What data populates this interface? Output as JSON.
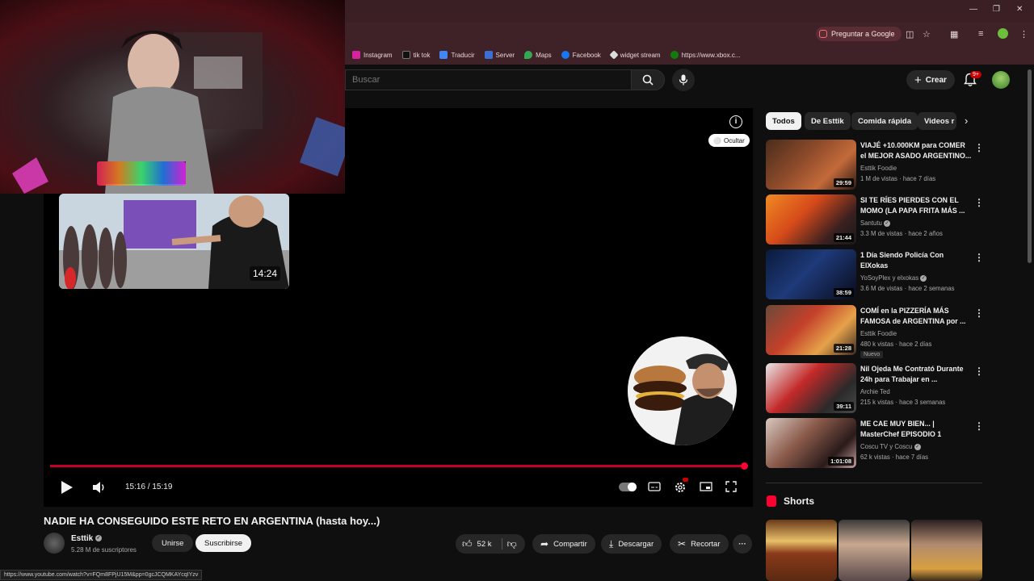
{
  "browser": {
    "ask_google": "Preguntar a Google",
    "bookmarks": [
      {
        "label": "Instagram",
        "color": "#d6249f"
      },
      {
        "label": "tik tok",
        "color": "#111111"
      },
      {
        "label": "Traducir",
        "color": "#4285f4"
      },
      {
        "label": "Server",
        "color": "#3b6fd6"
      },
      {
        "label": "Maps",
        "color": "#34a853"
      },
      {
        "label": "Facebook",
        "color": "#1877f2"
      },
      {
        "label": "widget stream",
        "color": "#dddddd"
      },
      {
        "label": "https://www.xbox.c...",
        "color": "#107c10"
      }
    ],
    "status_url": "https://www.youtube.com/watch?v=FQm8FPjU15M&pp=0gcJCQMKAYcqIYzv"
  },
  "header": {
    "search_placeholder": "Buscar",
    "create_label": "Crear",
    "notification_count": "9+"
  },
  "player": {
    "end_thumb_duration": "14:24",
    "hide_label": "Ocultar",
    "time": "15:16 / 15:19",
    "progress": 0.997
  },
  "video": {
    "title": "NADIE HA CONSEGUIDO ESTE RETO EN ARGENTINA (hasta hoy...)",
    "channel": "Esttik",
    "subscribers": "5.28 M de suscriptores",
    "join_label": "Unirse",
    "subscribe_label": "Suscribirse",
    "likes": "52 k",
    "share_label": "Compartir",
    "download_label": "Descargar",
    "clip_label": "Recortar"
  },
  "sidebar": {
    "chips": [
      "Todos",
      "De Esttik",
      "Comida rápida",
      "Videos r"
    ],
    "recommendations": [
      {
        "title": "VIAJÉ +10.000KM para COMER el MEJOR ASADO ARGENTINO...",
        "channel": "Esttik Foodie",
        "meta": "1 M de vistas · hace 7 días",
        "duration": "29:59",
        "badge": ""
      },
      {
        "title": "SI TE RÍES PIERDES CON EL MOMO (LA PAPA FRITA MÁS ...",
        "channel": "Santutu",
        "meta": "3.3 M de vistas · hace 2 años",
        "duration": "21:44",
        "badge": ""
      },
      {
        "title": "1 Día Siendo Policía Con ElXokas",
        "channel": "YoSoyPlex y elxokas",
        "meta": "3.6 M de vistas · hace 2 semanas",
        "duration": "38:59",
        "badge": ""
      },
      {
        "title": "COMÍ en la PIZZERÍA MÁS FAMOSA de ARGENTINA por ...",
        "channel": "Esttik Foodie",
        "meta": "480 k vistas · hace 2 días",
        "duration": "21:28",
        "badge": "Nuevo"
      },
      {
        "title": "Nil Ojeda Me Contrató Durante 24h para Trabajar en ...",
        "channel": "Archie Ted",
        "meta": "215 k vistas · hace 3 semanas",
        "duration": "39:11",
        "badge": ""
      },
      {
        "title": "ME CAE MUY BIEN... | MasterChef EPISODIO 1",
        "channel": "Coscu TV y Coscu",
        "meta": "62 k vistas · hace 7 días",
        "duration": "1:01:08",
        "badge": ""
      }
    ],
    "shorts_title": "Shorts"
  }
}
